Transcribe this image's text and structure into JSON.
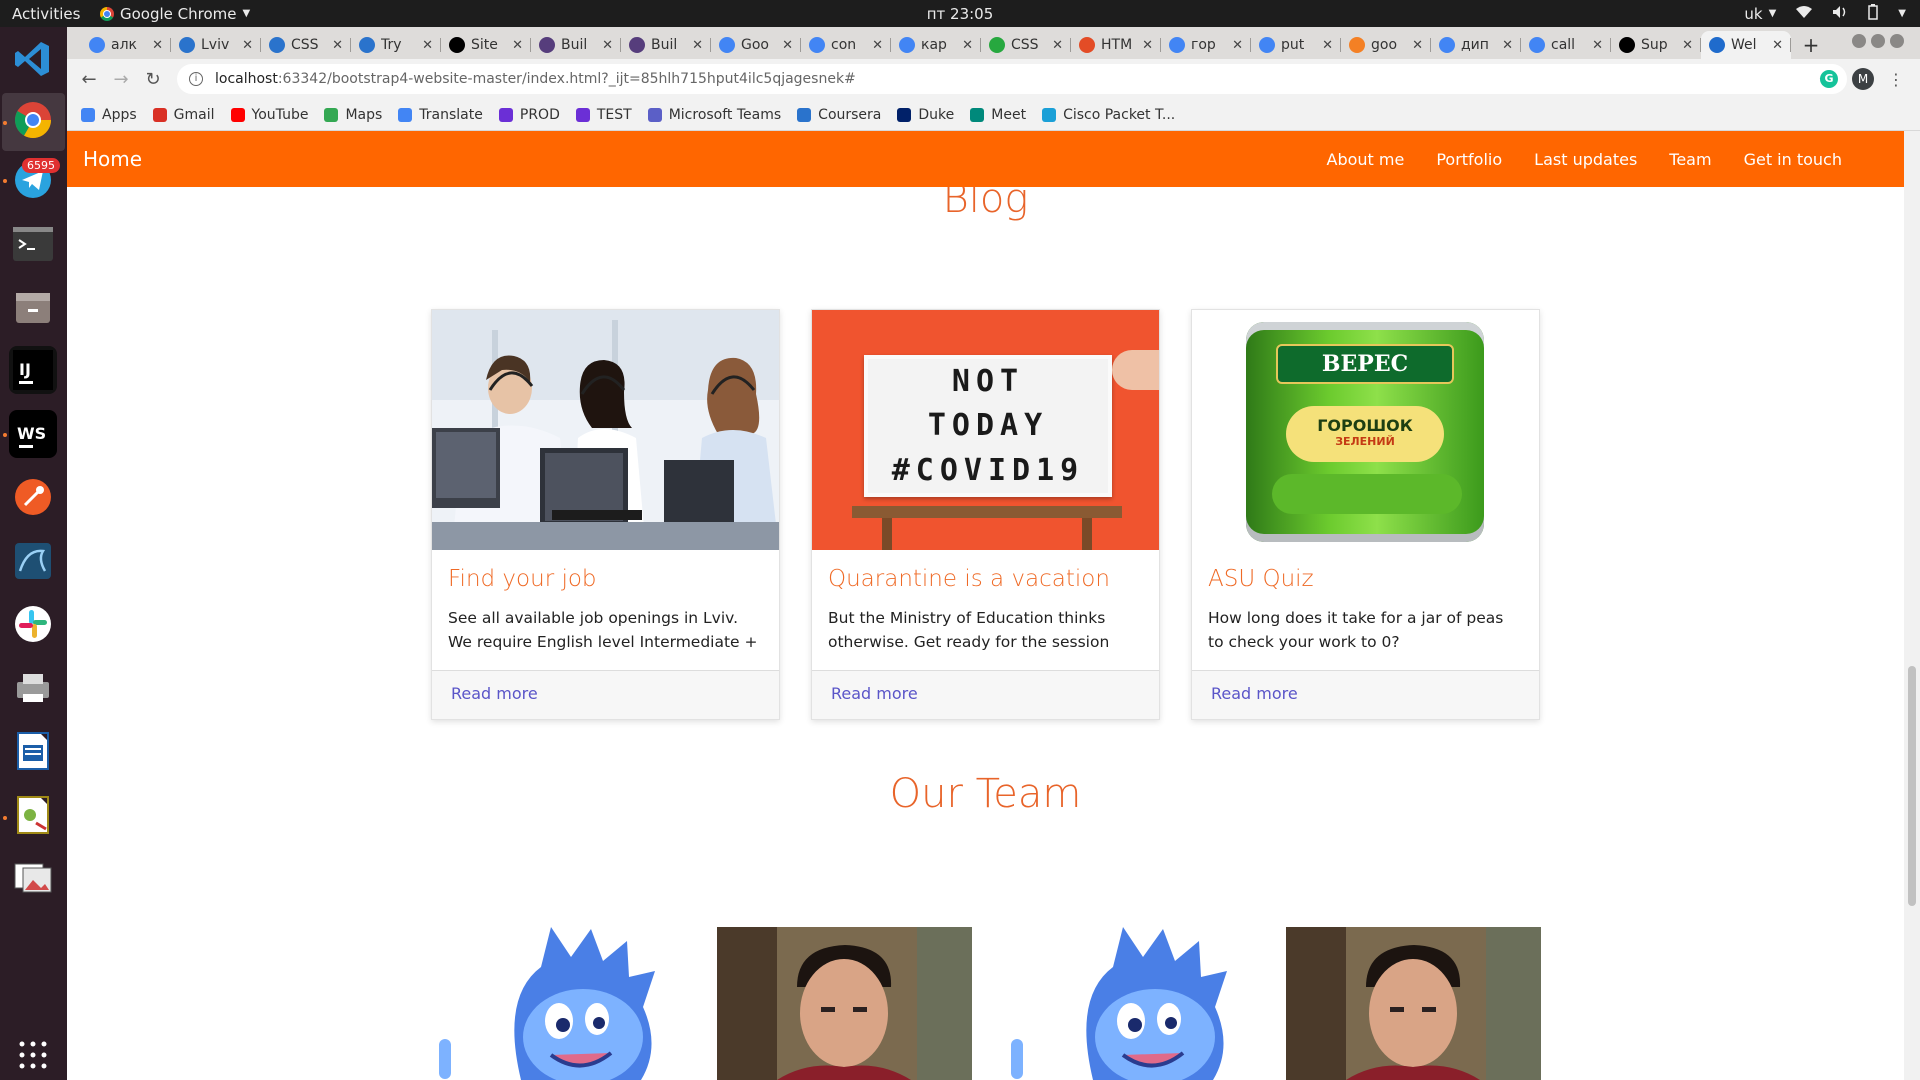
{
  "os": {
    "activities": "Activities",
    "app_name": "Google Chrome",
    "clock": "пт 23:05",
    "keyboard_layout": "uk",
    "telegram_badge": "6595"
  },
  "browser": {
    "tabs": [
      {
        "label": "алк",
        "icon": "google-icon",
        "color": "#4285f4"
      },
      {
        "label": "Lviv",
        "icon": "coursera-icon",
        "color": "#2a73cc"
      },
      {
        "label": "CSS",
        "icon": "coursera-icon",
        "color": "#2a73cc"
      },
      {
        "label": "Try",
        "icon": "coursera-icon",
        "color": "#2a73cc"
      },
      {
        "label": "Site",
        "icon": "codepen-icon",
        "color": "#000000"
      },
      {
        "label": "Buil",
        "icon": "bootstrap-icon",
        "color": "#563d7c"
      },
      {
        "label": "Buil",
        "icon": "bootstrap-icon",
        "color": "#563d7c"
      },
      {
        "label": "Goo",
        "icon": "translate-icon",
        "color": "#4285f4"
      },
      {
        "label": "con",
        "icon": "google-icon",
        "color": "#4285f4"
      },
      {
        "label": "кар",
        "icon": "google-icon",
        "color": "#4285f4"
      },
      {
        "label": "CSS",
        "icon": "css-icon",
        "color": "#27a83f"
      },
      {
        "label": "HTM",
        "icon": "html-icon",
        "color": "#e34c26"
      },
      {
        "label": "гор",
        "icon": "google-icon",
        "color": "#4285f4"
      },
      {
        "label": "put",
        "icon": "google-icon",
        "color": "#4285f4"
      },
      {
        "label": "goo",
        "icon": "stackoverflow-icon",
        "color": "#f48024"
      },
      {
        "label": "дип",
        "icon": "google-icon",
        "color": "#4285f4"
      },
      {
        "label": "call",
        "icon": "google-icon",
        "color": "#4285f4"
      },
      {
        "label": "Sup",
        "icon": "wikipedia-icon",
        "color": "#000000"
      },
      {
        "label": "Wel",
        "icon": "webstorm-icon",
        "color": "#1f6bcc",
        "active": true
      }
    ],
    "url_host": "localhost",
    "url_path": ":63342/bootstrap4-website-master/index.html?_ijt=85hlh715hput4ilc5qjagesnek#",
    "profile_initial": "M",
    "bookmarks": [
      {
        "label": "Apps",
        "color": "#4285f4"
      },
      {
        "label": "Gmail",
        "color": "#d93025"
      },
      {
        "label": "YouTube",
        "color": "#ff0000"
      },
      {
        "label": "Maps",
        "color": "#34a853"
      },
      {
        "label": "Translate",
        "color": "#4285f4"
      },
      {
        "label": "PROD",
        "color": "#6b2fd6"
      },
      {
        "label": "TEST",
        "color": "#6b2fd6"
      },
      {
        "label": "Microsoft Teams",
        "color": "#5b5fc7"
      },
      {
        "label": "Coursera",
        "color": "#2a73cc"
      },
      {
        "label": "Duke",
        "color": "#012169"
      },
      {
        "label": "Meet",
        "color": "#00897b"
      },
      {
        "label": "Cisco Packet T...",
        "color": "#1ba0d7"
      }
    ]
  },
  "site": {
    "accent": "#ff6600",
    "brand": "Home",
    "nav": [
      "About me",
      "Portfolio",
      "Last updates",
      "Team",
      "Get in touch"
    ],
    "blog_title": "Blog",
    "cards": [
      {
        "title": "Find your job",
        "text": "See all available job openings in Lviv. We require English level Intermediate +",
        "link": "Read more"
      },
      {
        "title": "Quarantine is a vacation",
        "text": "But the Ministry of Education thinks otherwise. Get ready for the session",
        "link": "Read more"
      },
      {
        "title": "ASU Quiz",
        "text": "How long does it take for a jar of peas to check your work to 0?",
        "link": "Read more"
      }
    ],
    "lightbox_lines": [
      "NOT",
      "TODAY",
      "#COVID19"
    ],
    "can_brand": "ВЕРЕС",
    "can_product": "ГОРОШОК",
    "can_sub": "ЗЕЛЕНИЙ",
    "team_title": "Our Team"
  }
}
